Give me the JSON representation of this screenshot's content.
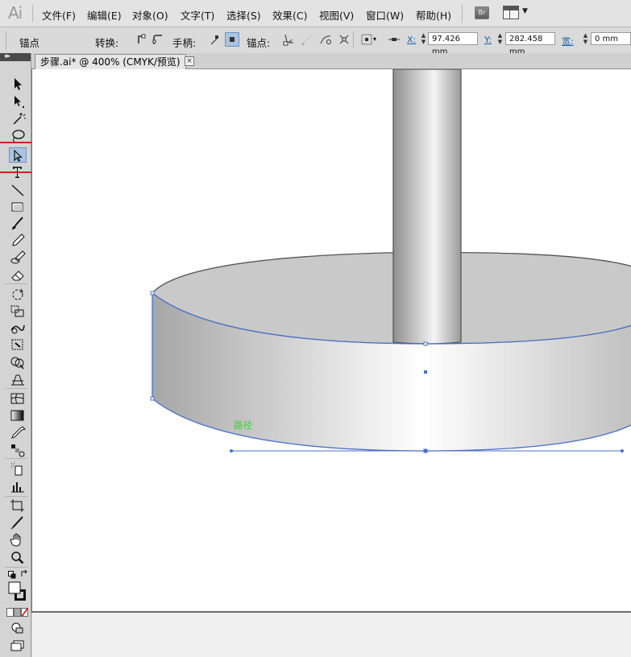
{
  "app": {
    "logo": "Ai"
  },
  "menu": {
    "items": [
      "文件(F)",
      "编辑(E)",
      "对象(O)",
      "文字(T)",
      "选择(S)",
      "效果(C)",
      "视图(V)",
      "窗口(W)",
      "帮助(H)"
    ],
    "bridge_label": "Br"
  },
  "control_bar": {
    "mode_label": "锚点",
    "convert_label": "转换:",
    "handles_label": "手柄:",
    "anchors_label": "锚点:",
    "x_label": "X:",
    "x_value": "97.426 mm",
    "y_label": "Y:",
    "y_value": "282.458 mm",
    "w_label": "宽:",
    "w_value": "0 mm"
  },
  "document": {
    "tab_title": "步骤.ai* @ 400% (CMYK/预览)",
    "tab_close": "×"
  },
  "canvas": {
    "path_tooltip": "路径",
    "selection_color": "#4b6fc8",
    "tooltip_color": "#3ad03a"
  },
  "toolbox": {
    "active_tool": "direct-selection-tool",
    "highlight_color": "#d91e1e"
  }
}
